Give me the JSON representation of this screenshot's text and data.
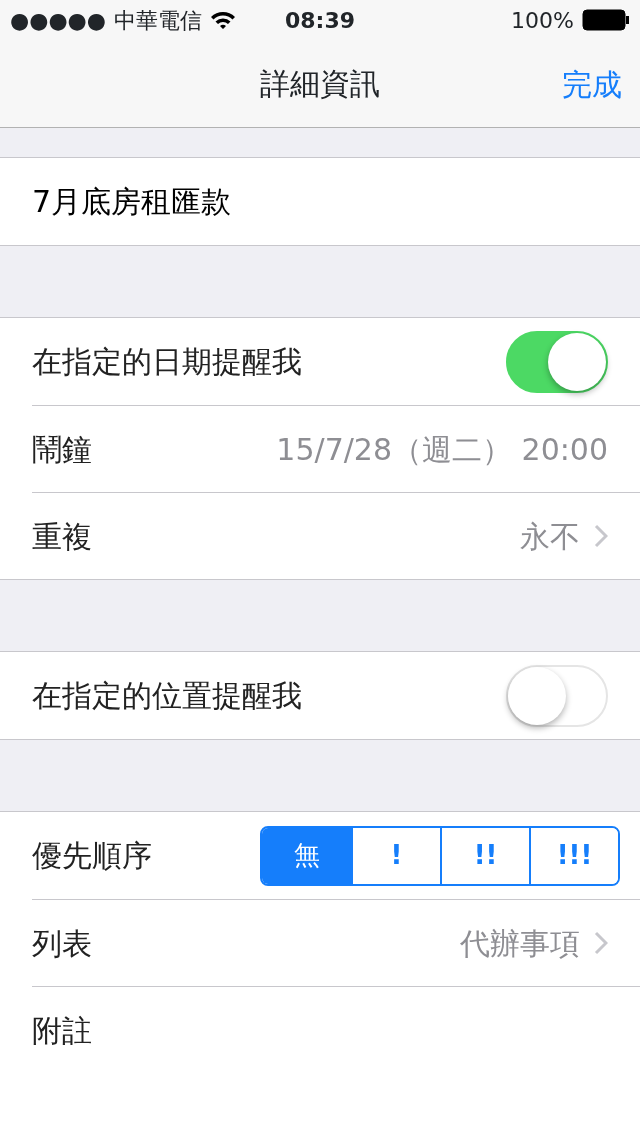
{
  "status_bar": {
    "signal_dots": "●●●●●",
    "carrier": "中華電信",
    "time": "08:39",
    "battery_text": "100%"
  },
  "nav": {
    "title": "詳細資訊",
    "done": "完成"
  },
  "sections": [
    {
      "rows": [
        {
          "kind": "title",
          "label": "7月底房租匯款"
        }
      ]
    },
    {
      "rows": [
        {
          "kind": "toggle",
          "label": "在指定的日期提醒我",
          "on": true
        },
        {
          "kind": "value",
          "label": "鬧鐘",
          "value": "15/7/28（週二） 20:00"
        },
        {
          "kind": "disclosure",
          "label": "重複",
          "value": "永不"
        }
      ]
    },
    {
      "rows": [
        {
          "kind": "toggle",
          "label": "在指定的位置提醒我",
          "on": false
        }
      ]
    },
    {
      "rows": [
        {
          "kind": "segmented",
          "label": "優先順序",
          "segments": [
            {
              "label": "無",
              "selected": true
            },
            {
              "label": "!",
              "selected": false
            },
            {
              "label": "!!",
              "selected": false
            },
            {
              "label": "!!!",
              "selected": false
            }
          ]
        },
        {
          "kind": "disclosure",
          "label": "列表",
          "value": "代辦事項"
        },
        {
          "kind": "plain",
          "label": "附註"
        }
      ]
    }
  ]
}
